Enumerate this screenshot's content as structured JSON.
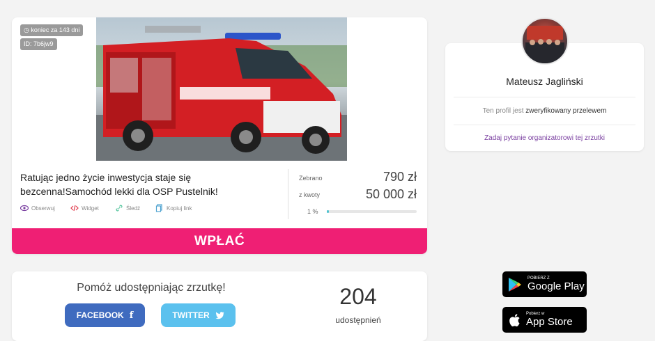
{
  "campaign": {
    "badges": {
      "days_left": "koniec za 143 dni",
      "id": "ID: 7b6jw9"
    },
    "title": "Ratując jedno życie inwestycja staje się bezcenna!Samochód lekki dla OSP Pustelnik!",
    "actions": [
      {
        "label": "Obserwuj",
        "icon": "eye-icon"
      },
      {
        "label": "Widget",
        "icon": "code-icon"
      },
      {
        "label": "Śledź",
        "icon": "link-icon"
      },
      {
        "label": "Kopiuj link",
        "icon": "copy-icon"
      }
    ],
    "stats": {
      "raised_label": "Zebrano",
      "raised_value": "790 zł",
      "goal_label": "z kwoty",
      "goal_value": "50 000 zł",
      "percent_label": "1 %",
      "progress": 0.02
    },
    "pay_label": "WPŁAĆ"
  },
  "organizer": {
    "name": "Mateusz Jagliński",
    "verified_prefix": "Ten profil jest ",
    "verified_bold": "zweryfikowany przelewem",
    "ask_link": "Zadaj pytanie organizatorowi tej zrzutki"
  },
  "share": {
    "title": "Pomóż udostępniając zrzutkę!",
    "facebook_label": "FACEBOOK",
    "twitter_label": "TWITTER",
    "count": "204",
    "count_label": "udostępnień"
  },
  "stores": {
    "google": {
      "small": "POBIERZ Z",
      "big": "Google Play"
    },
    "apple": {
      "small": "Pobierz w",
      "big": "App Store"
    }
  },
  "colors": {
    "accent": "#ef1f74",
    "facebook": "#3f6bbf",
    "twitter": "#5bc1ee",
    "link": "#7a3fa0",
    "progress": "#4fc3d0"
  }
}
